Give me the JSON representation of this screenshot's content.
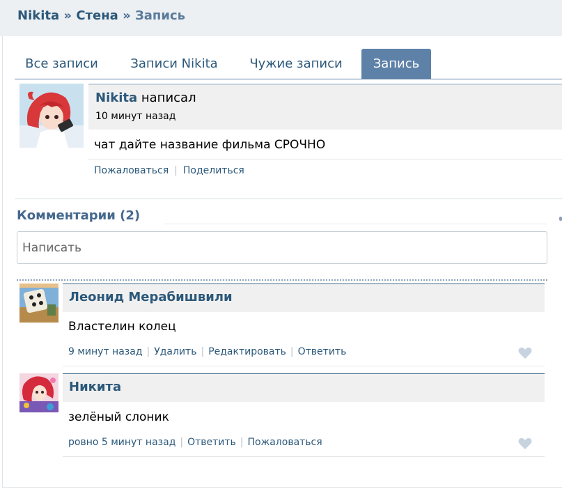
{
  "breadcrumb": {
    "owner": "Nikita",
    "separator": "»",
    "wall": "Стена",
    "current": "Запись"
  },
  "tabs": [
    {
      "label": "Все записи"
    },
    {
      "label": "Записи Nikita"
    },
    {
      "label": "Чужие записи"
    },
    {
      "label": "Запись",
      "active": true
    }
  ],
  "post": {
    "author": "Nikita",
    "action": "написал",
    "time": "10 минут назад",
    "text": "чат дайте название фильма СРОЧНО",
    "actions": {
      "report": "Пожаловаться",
      "share": "Поделиться"
    }
  },
  "comments_section": {
    "title": "Комментарии (2)",
    "input_placeholder": "Написать"
  },
  "comments": [
    {
      "author": "Леонид Мерабишвили",
      "text": "Властелин колец",
      "time": "9 минут назад",
      "actions": [
        "Удалить",
        "Редактировать",
        "Ответить"
      ]
    },
    {
      "author": "Никита",
      "text": "зелёный слоник",
      "time": "ровно 5 минут назад",
      "actions": [
        "Ответить",
        "Пожаловаться"
      ]
    }
  ],
  "colors": {
    "accent": "#5e81a8",
    "link": "#2b587a",
    "header_bg": "#edf0f3",
    "heart": "#c7d3df"
  },
  "icons": {
    "like": "heart-icon"
  }
}
